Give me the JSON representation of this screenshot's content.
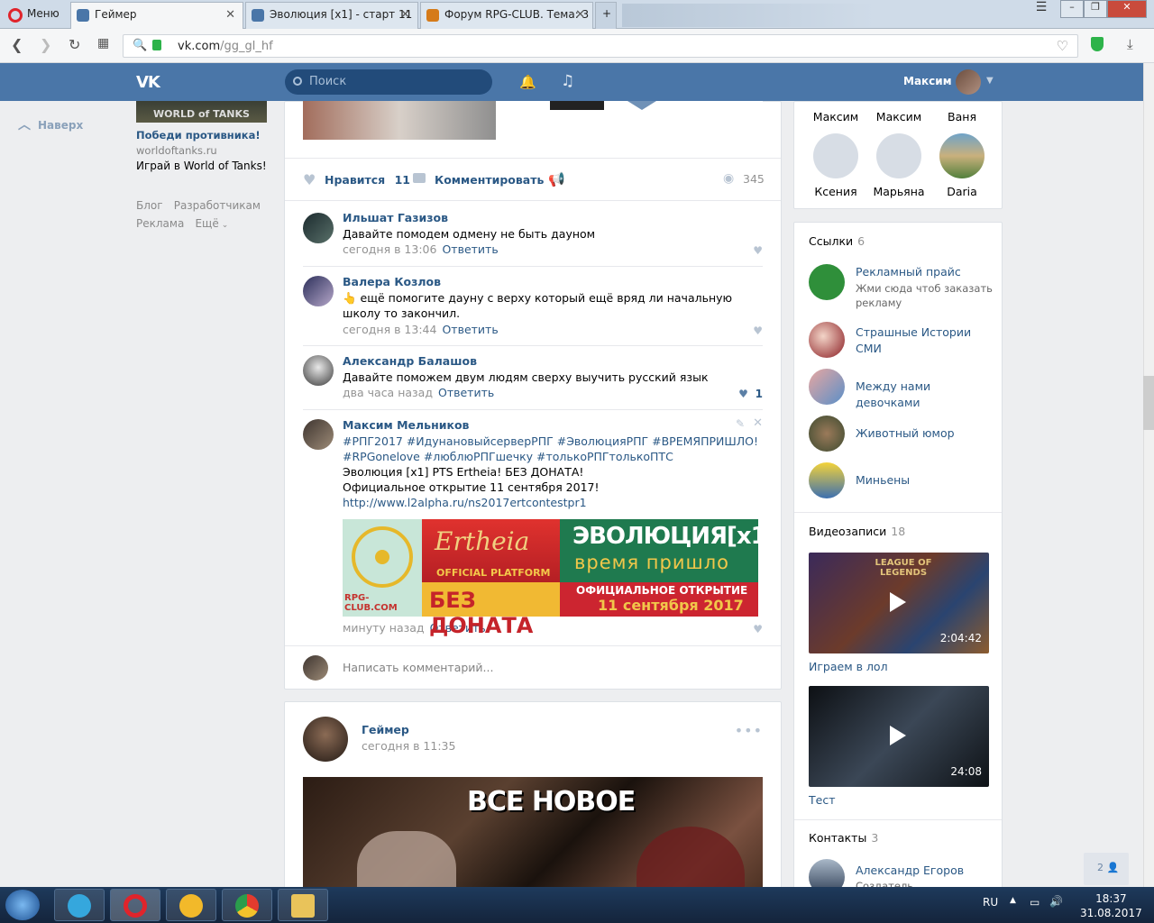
{
  "browser": {
    "menu_label": "Меню",
    "tabs": [
      {
        "title": "Геймер"
      },
      {
        "title": "Эволюция [x1] - старт 11"
      },
      {
        "title": "Форум RPG-CLUB. Тема: 3"
      }
    ],
    "new_tab": "+",
    "url_host": "vk.com",
    "url_path": "/gg_gl_hf"
  },
  "vk": {
    "search_placeholder": "Поиск",
    "user_name": "Максим",
    "back_to_top": "Наверх",
    "ad": {
      "image_text": "WORLD of TANKS",
      "title": "Победи противника!",
      "domain": "worldoftanks.ru",
      "text": "Играй в World of Tanks!"
    },
    "footer_links": [
      "Блог",
      "Разработчикам",
      "Реклама",
      "Ещё"
    ]
  },
  "post1": {
    "like_label": "Нравится",
    "like_count": "11",
    "comment_label": "Комментировать",
    "views": "345",
    "comments": [
      {
        "name": "Ильшат Газизов",
        "text": "Давайте помодем одмену не быть дауном",
        "time": "сегодня в 13:06",
        "reply": "Ответить"
      },
      {
        "name": "Валера Козлов",
        "text": "👆 ещё помогите дауну с верху который ещё вряд ли начальную школу то закончил.",
        "time": "сегодня в 13:44",
        "reply": "Ответить"
      },
      {
        "name": "Александр Балашов",
        "text": "Давайте поможем двум людям сверху выучить русский язык",
        "time": "два часа назад",
        "reply": "Ответить",
        "likes": "1"
      },
      {
        "name": "Максим Мельников",
        "tags1": "#РПГ2017 #ИдунановыйсерверРПГ #ЭволюцияРПГ #ВРЕМЯПРИШЛО!",
        "tags2": "#RPGonelove #люблюРПГшечку #толькоРПГтолькоПТС",
        "line3": "Эволюция [x1] PTS Ertheia! БЕЗ ДОНАТА!",
        "line4": "Официальное открытие 11 сентября 2017!",
        "link": "http://www.l2alpha.ru/ns2017ertcontestpr1",
        "time": "минуту назад",
        "reply": "Ответить"
      }
    ],
    "banner": {
      "site": "RPG-CLUB.COM",
      "brand": "Ertheia",
      "platform": "OFFICIAL PLATFORM",
      "no_donate": "БЕЗ ДОНАТА",
      "title": "ЭВОЛЮЦИЯ[x1]",
      "subtitle": "время пришло",
      "open1": "ОФИЦИАЛЬНОЕ ОТКРЫТИЕ",
      "open2": "11 сентября 2017"
    },
    "write_placeholder": "Написать комментарий..."
  },
  "post2": {
    "author": "Геймер",
    "time": "сегодня в 11:35",
    "image_text": "ВСЕ НОВОЕ"
  },
  "friends": [
    {
      "name": "Максим"
    },
    {
      "name": "Максим"
    },
    {
      "name": "Ваня"
    },
    {
      "name": "Ксения"
    },
    {
      "name": "Марьяна"
    },
    {
      "name": "Daria"
    }
  ],
  "links": {
    "title": "Ссылки",
    "count": "6",
    "items": [
      {
        "name": "Рекламный прайс",
        "desc": "Жми сюда чтоб заказать рекламу"
      },
      {
        "name": "Страшные Истории СМИ"
      },
      {
        "name": "Между нами девочками"
      },
      {
        "name": "Животный юмор"
      },
      {
        "name": "Миньены"
      }
    ]
  },
  "videos": {
    "title": "Видеозаписи",
    "count": "18",
    "items": [
      {
        "title": "Играем в лол",
        "duration": "2:04:42",
        "thumb_text": "LEAGUE OF LEGENDS"
      },
      {
        "title": "Тест",
        "duration": "24:08"
      }
    ]
  },
  "contacts": {
    "title": "Контакты",
    "count": "3",
    "first_name": "Александр Егоров",
    "first_role": "Создатель"
  },
  "float_badge": "2",
  "taskbar": {
    "lang": "RU",
    "time": "18:37",
    "date": "31.08.2017"
  },
  "colors": {
    "vk_header": "#4a76a8",
    "link": "#2a5885",
    "page_bg": "#edeef0"
  }
}
